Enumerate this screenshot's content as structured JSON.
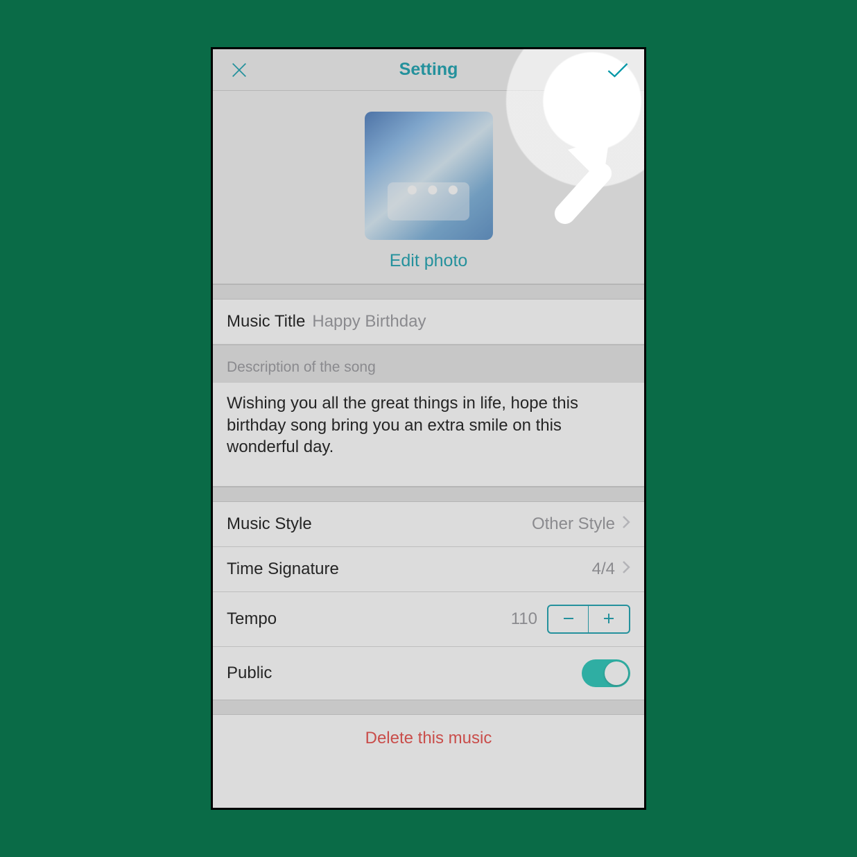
{
  "header": {
    "title": "Setting"
  },
  "photo": {
    "edit_label": "Edit photo"
  },
  "music_title": {
    "label": "Music Title",
    "value": "Happy Birthday"
  },
  "description": {
    "header": "Description of the song",
    "text": "Wishing you all the great things in life, hope this birthday song bring you an extra smile on this wonderful day."
  },
  "style": {
    "label": "Music Style",
    "value": "Other Style"
  },
  "time_signature": {
    "label": "Time Signature",
    "value": "4/4"
  },
  "tempo": {
    "label": "Tempo",
    "value": "110"
  },
  "public": {
    "label": "Public",
    "on": true
  },
  "delete": {
    "label": "Delete this music"
  },
  "colors": {
    "accent": "#0097a7",
    "danger": "#e53935",
    "toggle_on": "#10c0b0"
  }
}
